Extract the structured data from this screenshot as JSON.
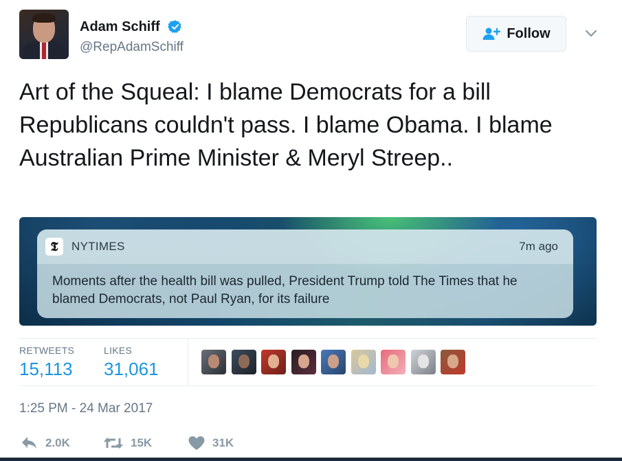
{
  "tweet": {
    "author_name": "Adam Schiff",
    "handle": "@RepAdamSchiff",
    "follow_label": "Follow",
    "text": "Art of the Squeal: I blame Democrats for a bill Republicans couldn't pass. I blame Obama. I blame Australian Prime Minister & Meryl Streep..",
    "timestamp": "1:25 PM - 24 Mar 2017"
  },
  "media": {
    "app_name": "NYTIMES",
    "time_ago": "7m ago",
    "message": "Moments after the health bill was pulled, President Trump told The Times that he blamed Democrats, not Paul Ryan, for its failure"
  },
  "stats": {
    "retweets_label": "RETWEETS",
    "retweets_value": "15,113",
    "likes_label": "LIKES",
    "likes_value": "31,061"
  },
  "actions": {
    "reply_count": "2.0K",
    "retweet_count": "15K",
    "like_count": "31K"
  },
  "colors": {
    "link_blue": "#1b95e0",
    "verified_blue": "#1da1f2",
    "muted_gray": "#657786"
  },
  "icons": [
    "verified-badge-icon",
    "follow-person-icon",
    "chevron-down-icon",
    "nyt-logo-icon",
    "reply-icon",
    "retweet-icon",
    "heart-icon"
  ]
}
